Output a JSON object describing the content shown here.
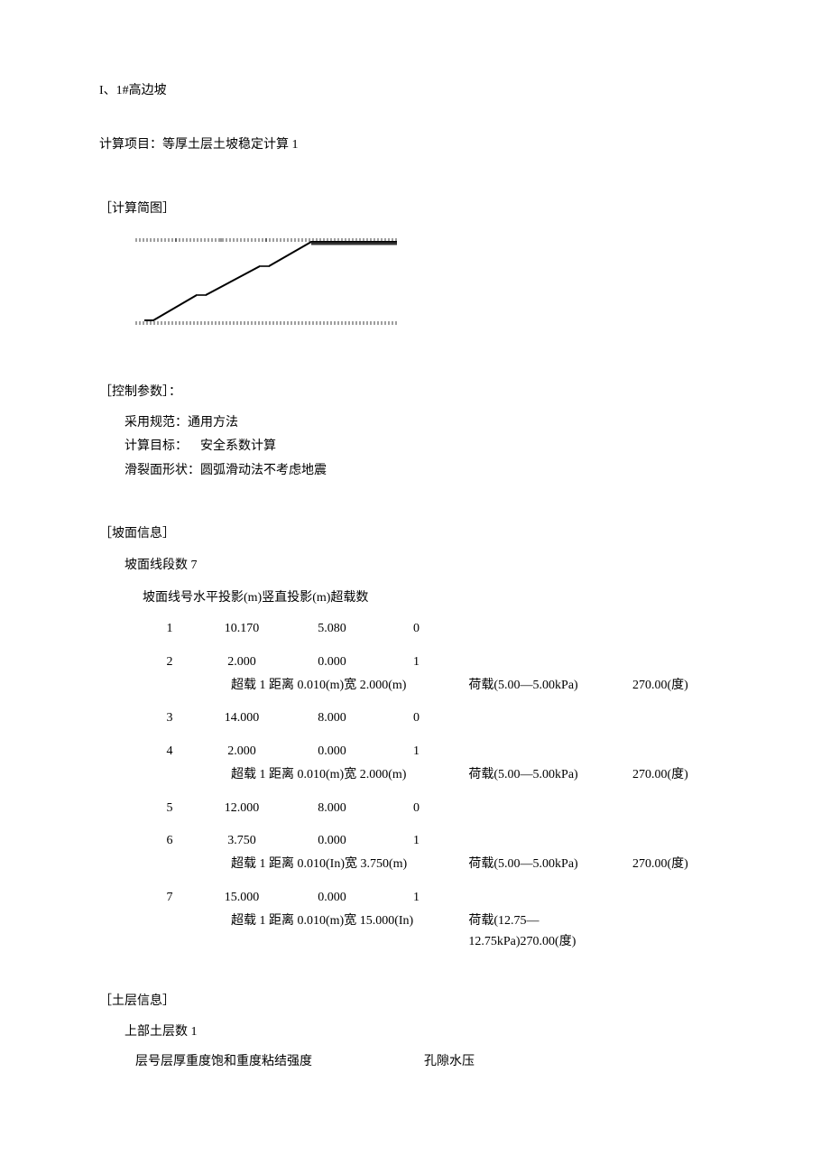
{
  "title": "I、1#高边坡",
  "calc_project": "计算项目：等厚土层土坡稳定计算 1",
  "diagram_heading": "［计算简图］",
  "control": {
    "heading": "［控制参数］：",
    "spec_label": "采用规范：",
    "spec_value": "通用方法",
    "target_label": "计算目标：",
    "target_value": "安全系数计算",
    "shape_label": "滑裂面形状：",
    "shape_value": "圆弧滑动法不考虑地震"
  },
  "slope": {
    "heading": "［坡面信息］",
    "count": "坡面线段数 7",
    "header": "坡面线号水平投影(m)竖直投影(m)超载数",
    "rows": [
      {
        "idx": "1",
        "h": "10.170",
        "v": "5.080",
        "over": "0",
        "extra": null
      },
      {
        "idx": "2",
        "h": "2.000",
        "v": "0.000",
        "over": "1",
        "extra": {
          "span": "超载 1 距离 0.010(m)宽 2.000(m)",
          "load": "荷载(5.00—5.00kPa)",
          "angle": "270.00(度)"
        }
      },
      {
        "idx": "3",
        "h": "14.000",
        "v": "8.000",
        "over": "0",
        "extra": null
      },
      {
        "idx": "4",
        "h": "2.000",
        "v": "0.000",
        "over": "1",
        "extra": {
          "span": "超载 1 距离 0.010(m)宽 2.000(m)",
          "load": "荷载(5.00—5.00kPa)",
          "angle": "270.00(度)"
        }
      },
      {
        "idx": "5",
        "h": "12.000",
        "v": "8.000",
        "over": "0",
        "extra": null
      },
      {
        "idx": "6",
        "h": "3.750",
        "v": "0.000",
        "over": "1",
        "extra": {
          "span": "超载 1 距离 0.010(In)宽 3.750(m)",
          "load": "荷载(5.00—5.00kPa)",
          "angle": "270.00(度)"
        }
      },
      {
        "idx": "7",
        "h": "15.000",
        "v": "0.000",
        "over": "1",
        "extra": {
          "span": "超载 1 距离 0.010(m)宽 15.000(In)",
          "load": "荷载(12.75—12.75kPa)270.00(度)",
          "angle": ""
        }
      }
    ]
  },
  "soil": {
    "heading": "［土层信息］",
    "count": "上部土层数 1",
    "header_left": "层号层厚重度饱和重度粘结强度",
    "header_right": "孔隙水压"
  }
}
